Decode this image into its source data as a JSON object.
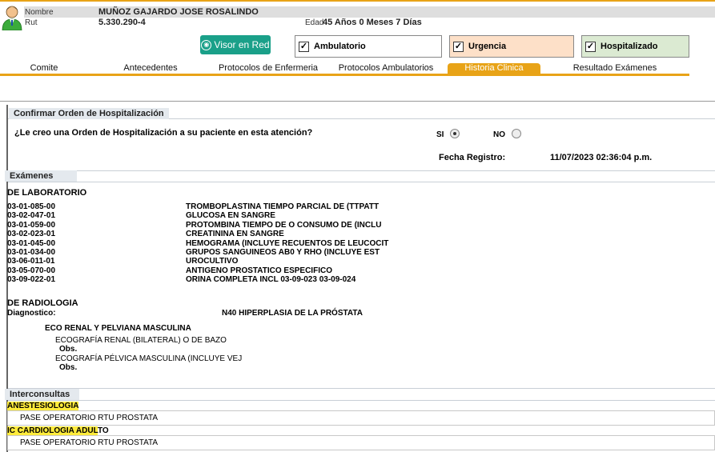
{
  "patient": {
    "name_label": "Nombre",
    "name": "MUÑOZ GAJARDO JOSE ROSALINDO",
    "rut_label": "Rut",
    "rut": "5.330.290-4",
    "age_label": "Edad",
    "age": "45 Años 0 Meses 7 Días"
  },
  "toolbar": {
    "visor_label": "Visor en Red",
    "ambulatorio_label": "Ambulatorio",
    "urgencia_label": "Urgencia",
    "hospitalizado_label": "Hospitalizado",
    "check_mark": "✓"
  },
  "tabs": [
    {
      "label": "Comite"
    },
    {
      "label": "Antecedentes"
    },
    {
      "label": "Protocolos de Enfermeria"
    },
    {
      "label": "Protocolos Ambulatorios"
    },
    {
      "label": "Historia Clinica"
    },
    {
      "label": "Resultado Exámenes"
    }
  ],
  "hospitalization": {
    "title": "Confirmar Orden de Hospitalización",
    "question": "¿Le creo una Orden de Hospitalización a su paciente en esta atención?",
    "si_label": "SI",
    "no_label": "NO",
    "fecha_label": "Fecha Registro:",
    "fecha_value": "11/07/2023 02:36:04 p.m."
  },
  "examenes": {
    "title": "Exámenes",
    "lab_title": "DE LABORATORIO",
    "lab_items": [
      {
        "code": "03-01-085-00",
        "desc": "TROMBOPLASTINA TIEMPO PARCIAL DE (TTPATT"
      },
      {
        "code": "03-02-047-01",
        "desc": "GLUCOSA EN SANGRE"
      },
      {
        "code": "03-01-059-00",
        "desc": "PROTOMBINA TIEMPO DE O CONSUMO DE (INCLU"
      },
      {
        "code": "03-02-023-01",
        "desc": "CREATININA EN SANGRE"
      },
      {
        "code": "03-01-045-00",
        "desc": "HEMOGRAMA (INCLUYE RECUENTOS DE LEUCOCIT"
      },
      {
        "code": "03-01-034-00",
        "desc": "GRUPOS SANGUINEOS AB0 Y RHO (INCLUYE EST"
      },
      {
        "code": "03-06-011-01",
        "desc": "UROCULTIVO"
      },
      {
        "code": "03-05-070-00",
        "desc": "ANTIGENO PROSTATICO ESPECIFICO"
      },
      {
        "code": "03-09-022-01",
        "desc": "ORINA COMPLETA INCL 03-09-023 03-09-024"
      }
    ],
    "rad_title": "DE RADIOLOGIA",
    "diag_label": "Diagnostico:",
    "diag_value": "N40 HIPERPLASIA DE LA PRÓSTATA",
    "rad_group": "ECO RENAL Y PELVIANA MASCULINA",
    "rad_items": [
      {
        "name": "ECOGRAFÍA RENAL (BILATERAL) O DE BAZO",
        "obs": "Obs."
      },
      {
        "name": "ECOGRAFÍA PÉLVICA MASCULINA (INCLUYE VEJ",
        "obs": "Obs."
      }
    ]
  },
  "interconsultas": {
    "title": "Interconsultas",
    "items": [
      {
        "specialty": "ANESTESIOLOGIA",
        "detail": "PASE OPERATORIO RTU PROSTATA"
      },
      {
        "specialty_hl": "IC CARDIOLOGIA ADUL",
        "specialty_rest": "TO",
        "detail": "PASE OPERATORIO RTU PROSTATA"
      }
    ]
  }
}
